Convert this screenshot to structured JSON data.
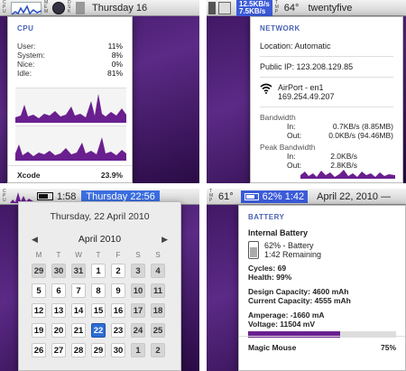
{
  "cpu_view": {
    "menubar_time": "Thursday 16",
    "title": "CPU",
    "stats": [
      {
        "label": "User:",
        "value": "11%"
      },
      {
        "label": "System:",
        "value": "8%"
      },
      {
        "label": "Nice:",
        "value": "0%"
      },
      {
        "label": "Idle:",
        "value": "81%"
      }
    ],
    "process": {
      "name": "Xcode",
      "value": "23.9%"
    }
  },
  "network_view": {
    "upload_speed": "12.5KB/s",
    "download_speed": "7.5KB/s",
    "temperature": "64°",
    "clock_text": "twentyfive",
    "title": "NETWORK",
    "location": "Location: Automatic",
    "public_ip": "Public IP: 123.208.129.85",
    "interface_name": "AirPort - en1",
    "interface_ip": "169.254.49.207",
    "bandwidth_title": "Bandwidth",
    "in_label": "In:",
    "in_value": "0.7KB/s (8.85MB)",
    "out_label": "Out:",
    "out_value": "0.0KB/s (94.46MB)",
    "peak_title": "Peak Bandwidth",
    "peak_in_value": "2.0KB/s",
    "peak_out_value": "2.8KB/s"
  },
  "calendar_view": {
    "menubar_time": "1:58",
    "menubar_date": "Thursday 22:56",
    "date_header": "Thursday, 22 April 2010",
    "month_label": "April 2010",
    "weekdays": [
      "M",
      "T",
      "W",
      "T",
      "F",
      "S",
      "S"
    ],
    "weeks": [
      [
        "29",
        "30",
        "31",
        "1",
        "2",
        "3",
        "4"
      ],
      [
        "5",
        "6",
        "7",
        "8",
        "9",
        "10",
        "11"
      ],
      [
        "12",
        "13",
        "14",
        "15",
        "16",
        "17",
        "18"
      ],
      [
        "19",
        "20",
        "21",
        "22",
        "23",
        "24",
        "25"
      ],
      [
        "26",
        "27",
        "28",
        "29",
        "30",
        "1",
        "2"
      ]
    ]
  },
  "battery_view": {
    "temperature": "61°",
    "menubar_battery": "62% 1:42",
    "menubar_date": "April 22, 2010 —",
    "title": "BATTERY",
    "internal_label": "Internal Battery",
    "percent_label": "62% - Battery",
    "remaining_label": "1:42 Remaining",
    "cycles": "Cycles: 69",
    "health": "Health: 99%",
    "design_capacity": "Design Capacity: 4600 mAh",
    "current_capacity": "Current Capacity: 4555 mAh",
    "amperage": "Amperage: -1660 mA",
    "voltage": "Voltage: 11504 mV",
    "charge_level": 0.62,
    "device_name": "Magic Mouse",
    "device_percent": "75%"
  },
  "colors": {
    "accent_blue": "#3b5bd8",
    "graph_purple": "#6a1f8f",
    "desktop_purple": "#4a1a72"
  }
}
